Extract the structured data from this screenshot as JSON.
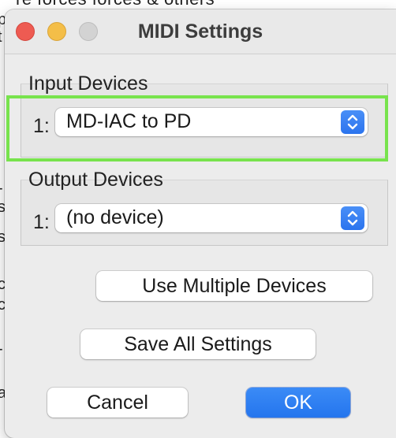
{
  "background": {
    "top_text": "re forces forces & others",
    "left_chars": [
      "p",
      "t",
      "-",
      "s",
      "s",
      "c",
      "c",
      "-",
      "a"
    ]
  },
  "window": {
    "title": "MIDI Settings"
  },
  "input_devices": {
    "label": "Input Devices",
    "index": "1:",
    "selected": "MD-IAC to PD"
  },
  "output_devices": {
    "label": "Output Devices",
    "index": "1:",
    "selected": "(no device)"
  },
  "buttons": {
    "use_multiple": "Use Multiple Devices",
    "save_all": "Save All Settings",
    "cancel": "Cancel",
    "ok": "OK"
  },
  "colors": {
    "accent": "#2b74ee",
    "focus_highlight": "#78e34d",
    "close": "#ee5b52",
    "minimize": "#f4be48",
    "zoom_disabled": "#d3d3d3"
  },
  "icons": {
    "popup_stepper": "chevron-up-down-icon"
  }
}
